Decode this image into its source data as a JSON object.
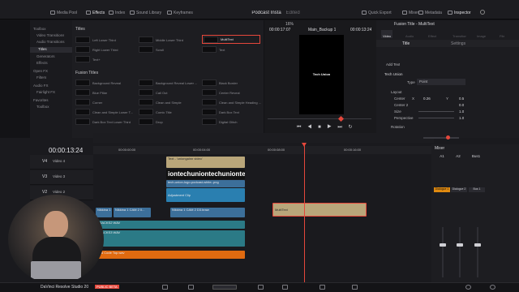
{
  "topbar": {
    "media_pool": "Media Pool",
    "effects": "Effects",
    "index": "Index",
    "sound_library": "Sound Library",
    "keyframes": "Keyframes",
    "project_title": "Podcast Insta",
    "project_status": "Edited",
    "quick_export": "Quick Export",
    "mixer": "Mixer",
    "metadata": "Metadata",
    "inspector": "Inspector"
  },
  "tree": [
    {
      "label": "Toolbox",
      "selected": false
    },
    {
      "label": "Video Transitions",
      "selected": false
    },
    {
      "label": "Audio Transitions",
      "selected": false
    },
    {
      "label": "Titles",
      "selected": true
    },
    {
      "label": "Generators",
      "selected": false
    },
    {
      "label": "Effects",
      "selected": false
    },
    {
      "label": "Open FX",
      "selected": false
    },
    {
      "label": "Filters",
      "selected": false
    },
    {
      "label": "Audio FX",
      "selected": false
    },
    {
      "label": "Fairlight FX",
      "selected": false
    },
    {
      "label": "Favorites",
      "selected": false
    },
    {
      "label": "Toolbox",
      "selected": false
    }
  ],
  "titles_panel": {
    "section1": "Titles",
    "section2": "Fusion Titles",
    "titles": [
      "Left Lower Third",
      "Middle Lower Third",
      "MultiText",
      "Right Lower Third",
      "Scroll",
      "Text",
      "Text+"
    ],
    "fusion_titles": [
      "Background Reveal",
      "Background Reveal Lower ...",
      "Black Border",
      "Blue Pillar",
      "Call Out",
      "Center Reveal",
      "Corner",
      "Clean and Simple",
      "Clean and Simple Heading ...",
      "Clean and Simple Lower T...",
      "Comic Title",
      "Dark Box Text",
      "Dark Box Text Lower Third",
      "Drop",
      "Digital Glitch"
    ]
  },
  "viewer": {
    "zoom": "16%",
    "timecode_left": "00:00:17:07",
    "timeline_name": "Main_Backup 1",
    "timecode_right": "00:00:13:24",
    "preview_text": "Tech Union"
  },
  "inspector": {
    "title": "Fusion Title - MultiText",
    "tabs": [
      "Video",
      "Audio",
      "Effect",
      "Transition",
      "Image",
      "File"
    ],
    "subtabs": [
      "Title",
      "Settings"
    ],
    "add_text": "Add Text",
    "layer_name": "Tech Union",
    "type_label": "Type",
    "type_value": "Point",
    "layout_label": "Layout",
    "center_label": "Center",
    "center_x_label": "X",
    "center_x": "0.26",
    "center_y_label": "Y",
    "center_y": "0.5",
    "center2_label": "Center 2",
    "center2_value": "0.0",
    "size_label": "Size",
    "size_value": "1.0",
    "perspective_label": "Perspective",
    "perspective_value": "1.0",
    "rotation_label": "Rotation"
  },
  "timeline": {
    "timecode": "00:00:13:24",
    "ruler": [
      "00:00:00:00",
      "00:00:04:00",
      "00:00:08:00",
      "00:00:12:00",
      "00:00:16:00",
      "00:00:20:00"
    ],
    "tracks": [
      {
        "id": "V4",
        "name": "Video 4"
      },
      {
        "id": "V3",
        "name": "Video 3"
      },
      {
        "id": "V2",
        "name": "Video 2"
      }
    ],
    "clips": {
      "text_small": "Text - 'uniongalnn video'",
      "big_text": "iontechuniontechuniontechunion",
      "logo": "tech-union-logo-podcast-white-.png",
      "adjustment": "Adjustment Clip",
      "nikkina1": "Nikkina 1",
      "nikkina_cam1": "Nikkina 1 CAM 2 0...",
      "nikkina_cam2": "Nikkina 1 CAM 2 D3.braw",
      "multitext": "MultiText",
      "audio1": "TRACKS2 WAV",
      "audio2": "TRACKS3 WAV",
      "orange": "Pod Code Top.wav"
    }
  },
  "mixer": {
    "title": "Mixer",
    "channels": [
      "A1",
      "A2",
      "Bus1"
    ],
    "inserts": [
      "Dialogue 1",
      "Dialogue 2",
      "Bus 1"
    ]
  },
  "bottom": {
    "app": "DaVinci Resolve Studio 20",
    "beta": "PUBLIC BETA"
  },
  "colors": {
    "accent": "#e5473b",
    "titles_clip": "#b9a67a",
    "adjustment_clip": "#2a7fb0",
    "video_clip": "#3c6f9a",
    "audio_clip": "#2b7a86",
    "orange_clip": "#e06a10",
    "playhead": "#e5473b"
  }
}
